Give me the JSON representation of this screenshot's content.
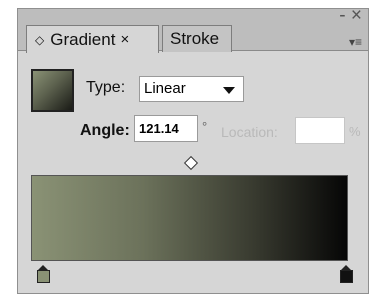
{
  "tabs": {
    "gradient": {
      "label": "Gradient",
      "close": "×",
      "options_glyph": "◇"
    },
    "stroke": {
      "label": "Stroke"
    }
  },
  "window_controls": {
    "minimize": "-",
    "close": "×"
  },
  "panel_menu": {
    "glyph": "▾≡"
  },
  "type": {
    "label": "Type:",
    "value": "Linear"
  },
  "angle": {
    "label": "Angle:",
    "value": "121.14",
    "degree": "°"
  },
  "location": {
    "label": "Location:",
    "value": "",
    "unit": "%"
  },
  "gradient": {
    "start_color": "#8a9275",
    "end_color": "#060606"
  }
}
